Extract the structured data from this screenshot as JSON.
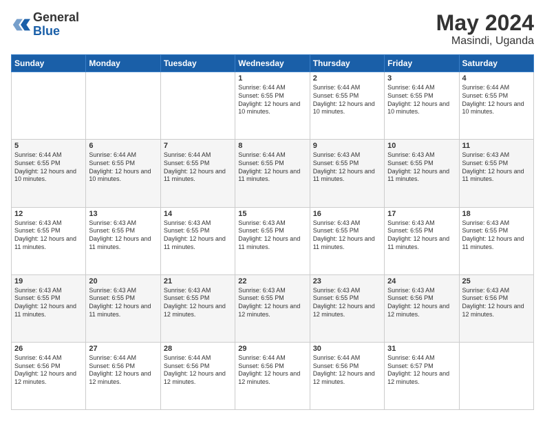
{
  "header": {
    "logo": {
      "general": "General",
      "blue": "Blue"
    },
    "title": "May 2024",
    "location": "Masindi, Uganda"
  },
  "weekdays": [
    "Sunday",
    "Monday",
    "Tuesday",
    "Wednesday",
    "Thursday",
    "Friday",
    "Saturday"
  ],
  "weeks": [
    [
      {
        "day": "",
        "info": ""
      },
      {
        "day": "",
        "info": ""
      },
      {
        "day": "",
        "info": ""
      },
      {
        "day": "1",
        "info": "Sunrise: 6:44 AM\nSunset: 6:55 PM\nDaylight: 12 hours and 10 minutes."
      },
      {
        "day": "2",
        "info": "Sunrise: 6:44 AM\nSunset: 6:55 PM\nDaylight: 12 hours and 10 minutes."
      },
      {
        "day": "3",
        "info": "Sunrise: 6:44 AM\nSunset: 6:55 PM\nDaylight: 12 hours and 10 minutes."
      },
      {
        "day": "4",
        "info": "Sunrise: 6:44 AM\nSunset: 6:55 PM\nDaylight: 12 hours and 10 minutes."
      }
    ],
    [
      {
        "day": "5",
        "info": "Sunrise: 6:44 AM\nSunset: 6:55 PM\nDaylight: 12 hours and 10 minutes."
      },
      {
        "day": "6",
        "info": "Sunrise: 6:44 AM\nSunset: 6:55 PM\nDaylight: 12 hours and 10 minutes."
      },
      {
        "day": "7",
        "info": "Sunrise: 6:44 AM\nSunset: 6:55 PM\nDaylight: 12 hours and 11 minutes."
      },
      {
        "day": "8",
        "info": "Sunrise: 6:44 AM\nSunset: 6:55 PM\nDaylight: 12 hours and 11 minutes."
      },
      {
        "day": "9",
        "info": "Sunrise: 6:43 AM\nSunset: 6:55 PM\nDaylight: 12 hours and 11 minutes."
      },
      {
        "day": "10",
        "info": "Sunrise: 6:43 AM\nSunset: 6:55 PM\nDaylight: 12 hours and 11 minutes."
      },
      {
        "day": "11",
        "info": "Sunrise: 6:43 AM\nSunset: 6:55 PM\nDaylight: 12 hours and 11 minutes."
      }
    ],
    [
      {
        "day": "12",
        "info": "Sunrise: 6:43 AM\nSunset: 6:55 PM\nDaylight: 12 hours and 11 minutes."
      },
      {
        "day": "13",
        "info": "Sunrise: 6:43 AM\nSunset: 6:55 PM\nDaylight: 12 hours and 11 minutes."
      },
      {
        "day": "14",
        "info": "Sunrise: 6:43 AM\nSunset: 6:55 PM\nDaylight: 12 hours and 11 minutes."
      },
      {
        "day": "15",
        "info": "Sunrise: 6:43 AM\nSunset: 6:55 PM\nDaylight: 12 hours and 11 minutes."
      },
      {
        "day": "16",
        "info": "Sunrise: 6:43 AM\nSunset: 6:55 PM\nDaylight: 12 hours and 11 minutes."
      },
      {
        "day": "17",
        "info": "Sunrise: 6:43 AM\nSunset: 6:55 PM\nDaylight: 12 hours and 11 minutes."
      },
      {
        "day": "18",
        "info": "Sunrise: 6:43 AM\nSunset: 6:55 PM\nDaylight: 12 hours and 11 minutes."
      }
    ],
    [
      {
        "day": "19",
        "info": "Sunrise: 6:43 AM\nSunset: 6:55 PM\nDaylight: 12 hours and 11 minutes."
      },
      {
        "day": "20",
        "info": "Sunrise: 6:43 AM\nSunset: 6:55 PM\nDaylight: 12 hours and 11 minutes."
      },
      {
        "day": "21",
        "info": "Sunrise: 6:43 AM\nSunset: 6:55 PM\nDaylight: 12 hours and 12 minutes."
      },
      {
        "day": "22",
        "info": "Sunrise: 6:43 AM\nSunset: 6:55 PM\nDaylight: 12 hours and 12 minutes."
      },
      {
        "day": "23",
        "info": "Sunrise: 6:43 AM\nSunset: 6:55 PM\nDaylight: 12 hours and 12 minutes."
      },
      {
        "day": "24",
        "info": "Sunrise: 6:43 AM\nSunset: 6:56 PM\nDaylight: 12 hours and 12 minutes."
      },
      {
        "day": "25",
        "info": "Sunrise: 6:43 AM\nSunset: 6:56 PM\nDaylight: 12 hours and 12 minutes."
      }
    ],
    [
      {
        "day": "26",
        "info": "Sunrise: 6:44 AM\nSunset: 6:56 PM\nDaylight: 12 hours and 12 minutes."
      },
      {
        "day": "27",
        "info": "Sunrise: 6:44 AM\nSunset: 6:56 PM\nDaylight: 12 hours and 12 minutes."
      },
      {
        "day": "28",
        "info": "Sunrise: 6:44 AM\nSunset: 6:56 PM\nDaylight: 12 hours and 12 minutes."
      },
      {
        "day": "29",
        "info": "Sunrise: 6:44 AM\nSunset: 6:56 PM\nDaylight: 12 hours and 12 minutes."
      },
      {
        "day": "30",
        "info": "Sunrise: 6:44 AM\nSunset: 6:56 PM\nDaylight: 12 hours and 12 minutes."
      },
      {
        "day": "31",
        "info": "Sunrise: 6:44 AM\nSunset: 6:57 PM\nDaylight: 12 hours and 12 minutes."
      },
      {
        "day": "",
        "info": ""
      }
    ]
  ]
}
